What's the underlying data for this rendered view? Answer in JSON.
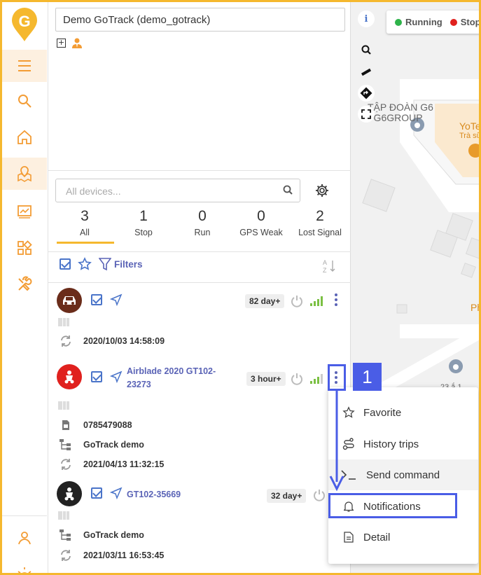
{
  "account": {
    "selected": "Demo GoTrack (demo_gotrack)"
  },
  "sidebar": {
    "items": [
      "menu-icon",
      "search-icon",
      "home-icon",
      "map-route-icon",
      "report-icon",
      "dashboard-icon",
      "tools-icon",
      "user-icon",
      "alarm-icon"
    ]
  },
  "search": {
    "placeholder": "All devices..."
  },
  "counts": [
    {
      "n": "3",
      "label": "All"
    },
    {
      "n": "1",
      "label": "Stop"
    },
    {
      "n": "0",
      "label": "Run"
    },
    {
      "n": "0",
      "label": "GPS Weak"
    },
    {
      "n": "2",
      "label": "Lost Signal"
    }
  ],
  "toolbar": {
    "filters_label": "Filters",
    "sort_label": "A Z"
  },
  "devices": [
    {
      "name": "",
      "badge": "82 day+",
      "timestamp": "2020/10/03 14:58:09"
    },
    {
      "name": "Airblade 2020 GT102-23273",
      "name_line1": "Airblade 2020 GT102-",
      "name_line2": "23273",
      "badge": "3 hour+",
      "phone": "0785479088",
      "group": "GoTrack demo",
      "timestamp": "2021/04/13 11:32:15"
    },
    {
      "name": "GT102-35669",
      "badge": "32 day+",
      "group": "GoTrack demo",
      "timestamp": "2021/03/11 16:53:45"
    }
  ],
  "map": {
    "legend": {
      "running": "Running",
      "stop": "Stop",
      "running_color": "#2eb34a",
      "stop_color": "#e0211e"
    },
    "labels": {
      "poi1_line1": "TẬP ĐOÀN G6",
      "poi1_line2": "- G6GROUP",
      "poi2_line1": "YoTe",
      "poi2_line2": "Trà sữ",
      "poi3": "Phi",
      "poi4": "23 ắ 1"
    }
  },
  "context_menu": {
    "items": [
      "Favorite",
      "History trips",
      "Send command",
      "Notifications",
      "Detail"
    ]
  },
  "callout": {
    "number": "1"
  },
  "colors": {
    "accent": "#f5b82e",
    "link": "#5a63b6",
    "callout": "#4a5de6"
  }
}
